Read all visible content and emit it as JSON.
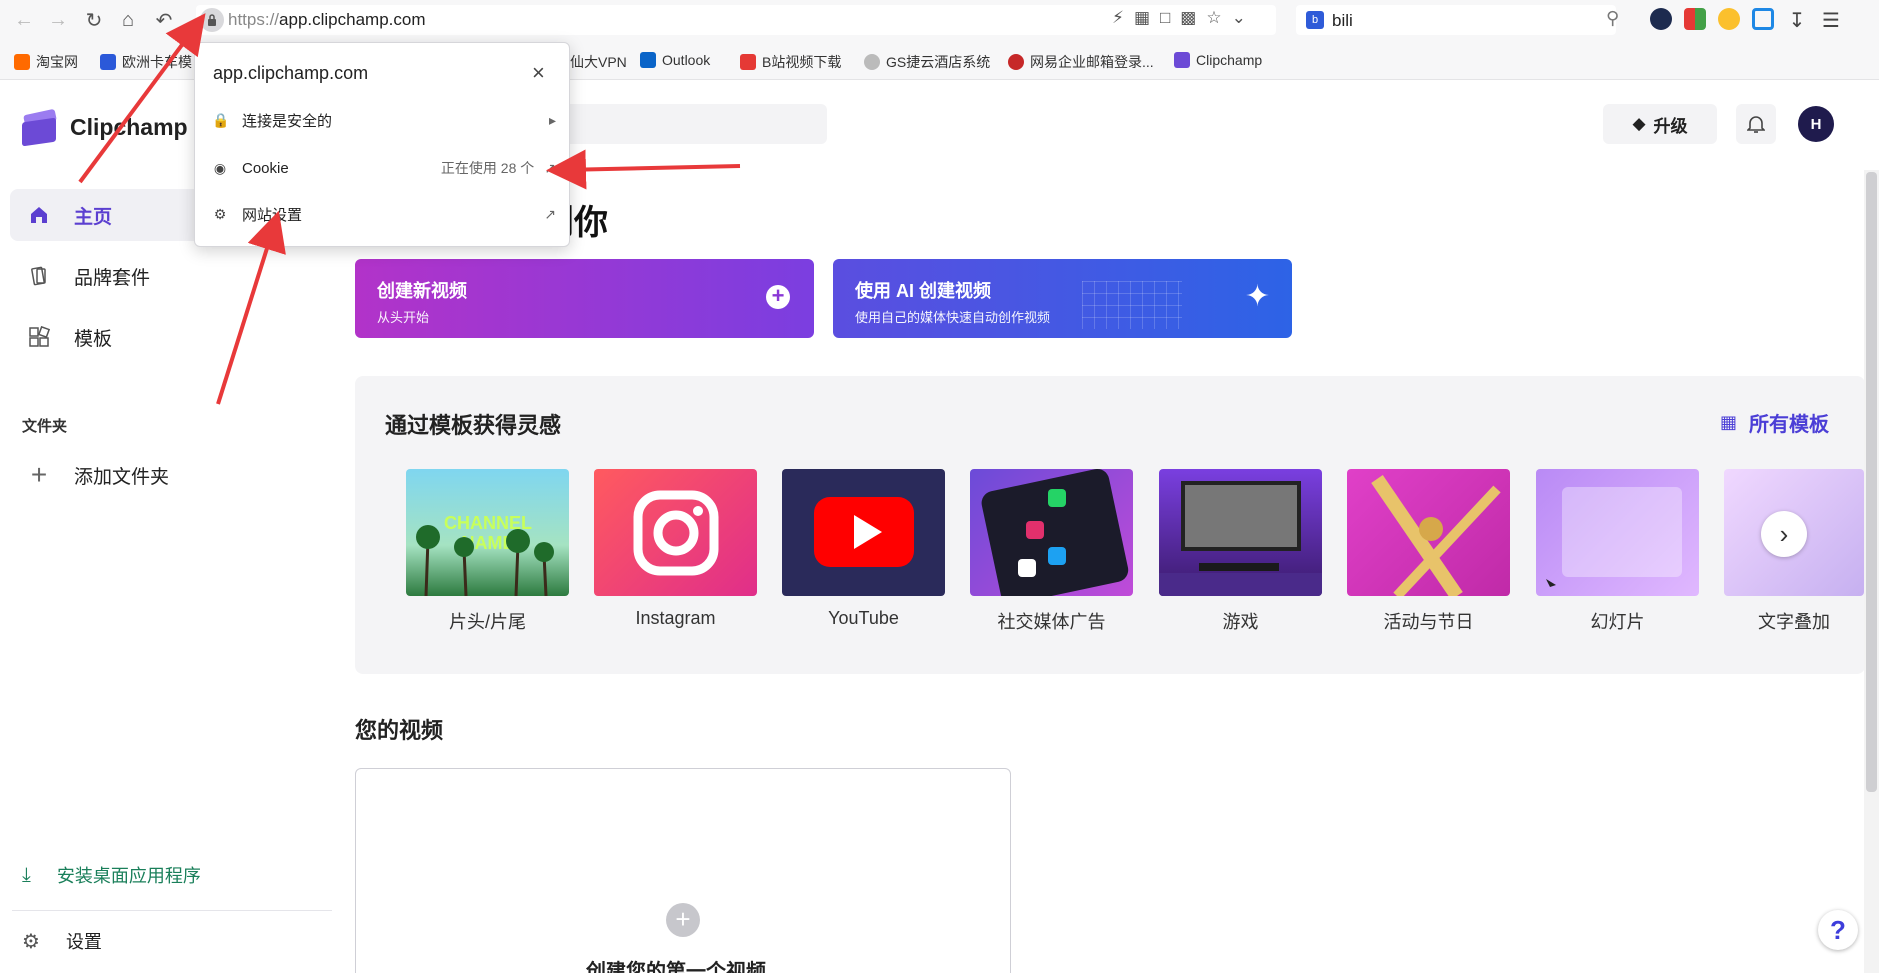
{
  "browser": {
    "url_protocol": "https://",
    "url_host": "app.clipchamp.com",
    "search_text": "bili",
    "bookmarks": [
      {
        "label": "淘宝网",
        "color": "#ff6a00"
      },
      {
        "label": "欧洲卡车模",
        "color": "#2b59d9"
      },
      {
        "label": "仙大VPN",
        "color": "#888888"
      },
      {
        "label": "Outlook",
        "color": "#0a64c8"
      },
      {
        "label": "B站视频下载",
        "color": "#e53935"
      },
      {
        "label": "GS捷云酒店系统",
        "color": "#666666"
      },
      {
        "label": "网易企业邮箱登录...",
        "color": "#c62828"
      },
      {
        "label": "Clipchamp",
        "color": "#6c4ad6"
      }
    ]
  },
  "popup": {
    "title": "app.clipchamp.com",
    "rows": [
      {
        "icon": "lock-icon",
        "label": "连接是安全的",
        "right": ""
      },
      {
        "icon": "cookie-icon",
        "label": "Cookie",
        "right": "正在使用 28 个"
      },
      {
        "icon": "gear-icon",
        "label": "网站设置",
        "right": ""
      }
    ]
  },
  "app": {
    "logo_text": "Clipchamp",
    "upgrade_label": "升级",
    "avatar_initial": "H",
    "heading_partial": "到你",
    "sidebar": {
      "items": [
        {
          "label": "主页",
          "icon": "home-icon"
        },
        {
          "label": "品牌套件",
          "icon": "brand-kit-icon"
        },
        {
          "label": "模板",
          "icon": "templates-icon"
        }
      ],
      "folder_section": "文件夹",
      "add_folder": "添加文件夹",
      "install": "安装桌面应用程序",
      "settings": "设置"
    },
    "cta": {
      "create_title": "创建新视频",
      "create_sub": "从头开始",
      "ai_title": "使用 AI 创建视频",
      "ai_sub": "使用自己的媒体快速自动创作视频"
    },
    "templates": {
      "title": "通过模板获得灵感",
      "all_label": "所有模板",
      "items": [
        "片头/片尾",
        "Instagram",
        "YouTube",
        "社交媒体广告",
        "游戏",
        "活动与节日",
        "幻灯片",
        "文字叠加"
      ]
    },
    "videos": {
      "title": "您的视频",
      "create_first": "创建您的第一个视频"
    }
  },
  "colors": {
    "accent": "#5b3fd0",
    "arrow": "#e8393a",
    "install_green": "#1a7f5a"
  }
}
